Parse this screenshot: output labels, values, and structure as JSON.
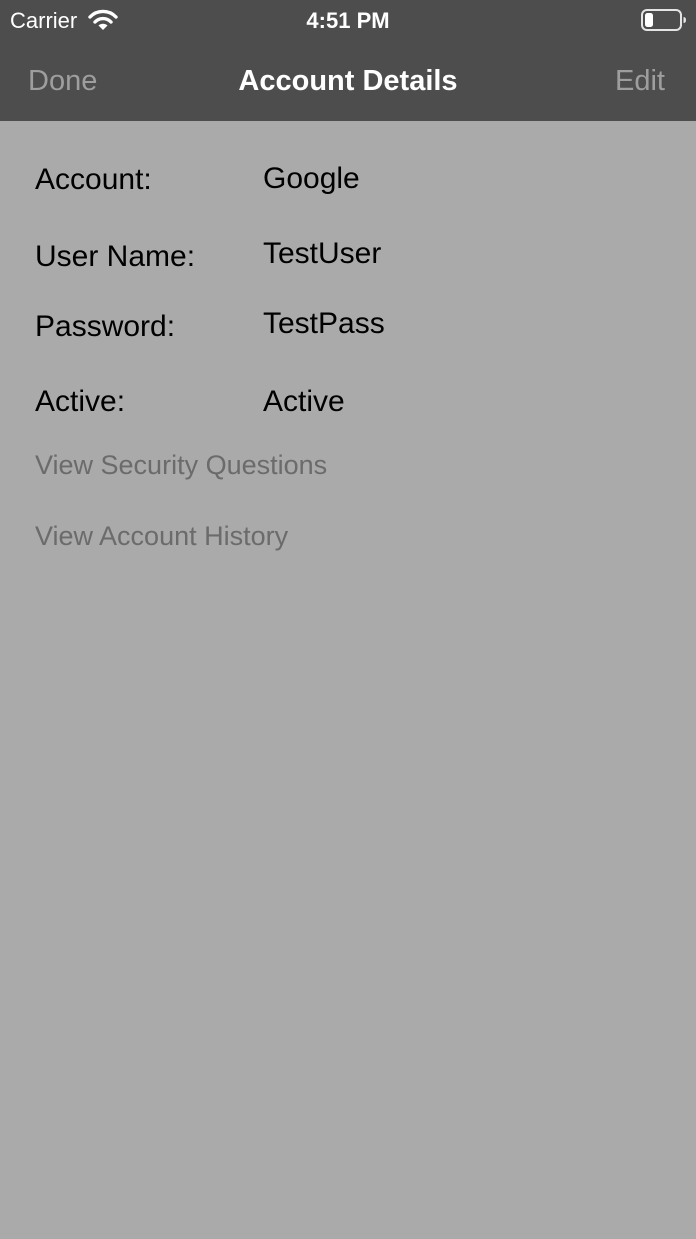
{
  "status_bar": {
    "carrier": "Carrier",
    "time": "4:51 PM",
    "icons": [
      "wifi-icon",
      "battery-icon"
    ]
  },
  "nav": {
    "left_button": "Done",
    "title": "Account Details",
    "right_button": "Edit"
  },
  "details": {
    "account": {
      "label": "Account:",
      "value": "Google"
    },
    "username": {
      "label": "User Name:",
      "value": "TestUser"
    },
    "password": {
      "label": "Password:",
      "value": "TestPass"
    },
    "active": {
      "label": "Active:",
      "value": "Active"
    }
  },
  "links": {
    "security_questions": "View Security Questions",
    "account_history": "View Account History"
  },
  "colors": {
    "nav_background": "#4d4d4d",
    "page_background": "#aaaaaa",
    "nav_button_text": "#9e9e9e",
    "link_text": "#6b6b6b"
  }
}
